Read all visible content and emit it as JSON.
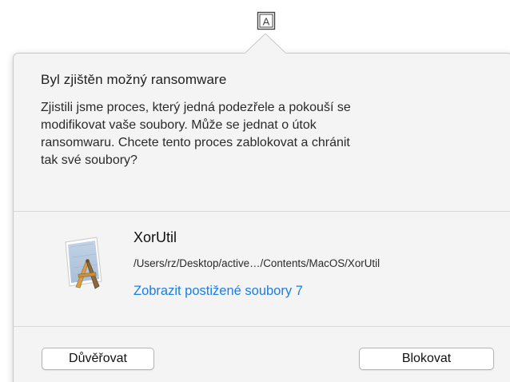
{
  "menubar": {
    "icon": "ransomware-monitor-a-icon",
    "icon_letter": "A"
  },
  "alert": {
    "title": "Byl zjištěn možný ransomware",
    "message": "Zjistili jsme proces, který jedná podezřele a pokouší se\nmodifikovat vaše soubory. Může se jednat o útok\nransomwaru. Chcete tento proces zablokovat a chránit\ntak své soubory?"
  },
  "process": {
    "icon": "xcode-app-icon",
    "name": "XorUtil",
    "path": "/Users/rz/Desktop/active…/Contents/MacOS/XorUtil",
    "affected_files_link": "Zobrazit postižené soubory 7"
  },
  "buttons": {
    "trust_label": "Důvěřovat",
    "block_label": "Blokovat"
  },
  "colors": {
    "link": "#1d7de8",
    "popover_background": "#f4f4f4"
  }
}
